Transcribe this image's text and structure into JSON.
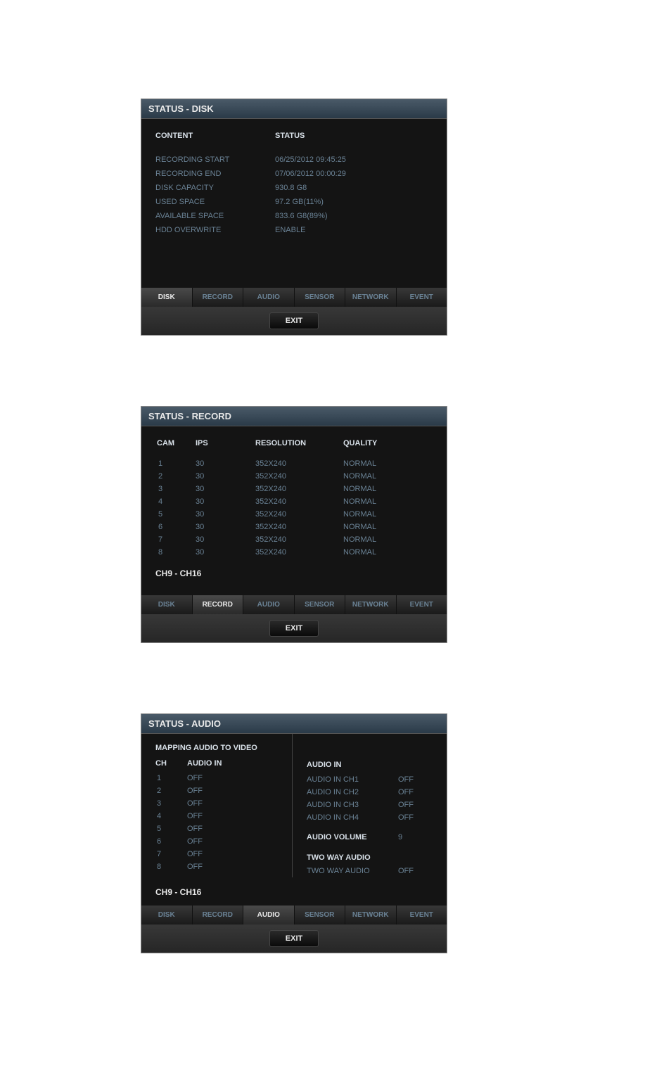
{
  "panels": {
    "disk": {
      "title": "STATUS - DISK",
      "headers": {
        "content": "CONTENT",
        "status": "STATUS"
      },
      "rows": [
        {
          "label": "RECORDING START",
          "value": "06/25/2012 09:45:25"
        },
        {
          "label": "RECORDING END",
          "value": "07/06/2012 00:00:29"
        },
        {
          "label": "DISK CAPACITY",
          "value": "930.8 G8"
        },
        {
          "label": "USED SPACE",
          "value": "97.2 GB(11%)"
        },
        {
          "label": "AVAILABLE SPACE",
          "value": "833.6 G8(89%)"
        },
        {
          "label": "HDD OVERWRITE",
          "value": "ENABLE"
        }
      ],
      "activeTab": "DISK"
    },
    "record": {
      "title": "STATUS - RECORD",
      "headers": {
        "cam": "CAM",
        "ips": "IPS",
        "resolution": "RESOLUTION",
        "quality": "QUALITY"
      },
      "rows": [
        {
          "cam": "1",
          "ips": "30",
          "resolution": "352X240",
          "quality": "NORMAL"
        },
        {
          "cam": "2",
          "ips": "30",
          "resolution": "352X240",
          "quality": "NORMAL"
        },
        {
          "cam": "3",
          "ips": "30",
          "resolution": "352X240",
          "quality": "NORMAL"
        },
        {
          "cam": "4",
          "ips": "30",
          "resolution": "352X240",
          "quality": "NORMAL"
        },
        {
          "cam": "5",
          "ips": "30",
          "resolution": "352X240",
          "quality": "NORMAL"
        },
        {
          "cam": "6",
          "ips": "30",
          "resolution": "352X240",
          "quality": "NORMAL"
        },
        {
          "cam": "7",
          "ips": "30",
          "resolution": "352X240",
          "quality": "NORMAL"
        },
        {
          "cam": "8",
          "ips": "30",
          "resolution": "352X240",
          "quality": "NORMAL"
        }
      ],
      "channelRange": "CH9 - CH16",
      "activeTab": "RECORD"
    },
    "audio": {
      "title": "STATUS - AUDIO",
      "mappingTitle": "MAPPING AUDIO TO VIDEO",
      "mapHeaders": {
        "ch": "CH",
        "audioIn": "AUDIO IN"
      },
      "mapRows": [
        {
          "ch": "1",
          "val": "OFF"
        },
        {
          "ch": "2",
          "val": "OFF"
        },
        {
          "ch": "3",
          "val": "OFF"
        },
        {
          "ch": "4",
          "val": "OFF"
        },
        {
          "ch": "5",
          "val": "OFF"
        },
        {
          "ch": "6",
          "val": "OFF"
        },
        {
          "ch": "7",
          "val": "OFF"
        },
        {
          "ch": "8",
          "val": "OFF"
        }
      ],
      "rightHeader": "AUDIO IN",
      "audioInRows": [
        {
          "label": "AUDIO IN CH1",
          "val": "OFF"
        },
        {
          "label": "AUDIO IN CH2",
          "val": "OFF"
        },
        {
          "label": "AUDIO IN CH3",
          "val": "OFF"
        },
        {
          "label": "AUDIO IN CH4",
          "val": "OFF"
        }
      ],
      "volumeTitle": "AUDIO VOLUME",
      "volumeValue": "9",
      "twoWayTitle": "TWO WAY AUDIO",
      "twoWayLabel": "TWO WAY AUDIO",
      "twoWayValue": "OFF",
      "channelRange": "CH9 - CH16",
      "activeTab": "AUDIO"
    }
  },
  "tabs": [
    "DISK",
    "RECORD",
    "AUDIO",
    "SENSOR",
    "NETWORK",
    "EVENT"
  ],
  "exitLabel": "EXIT"
}
